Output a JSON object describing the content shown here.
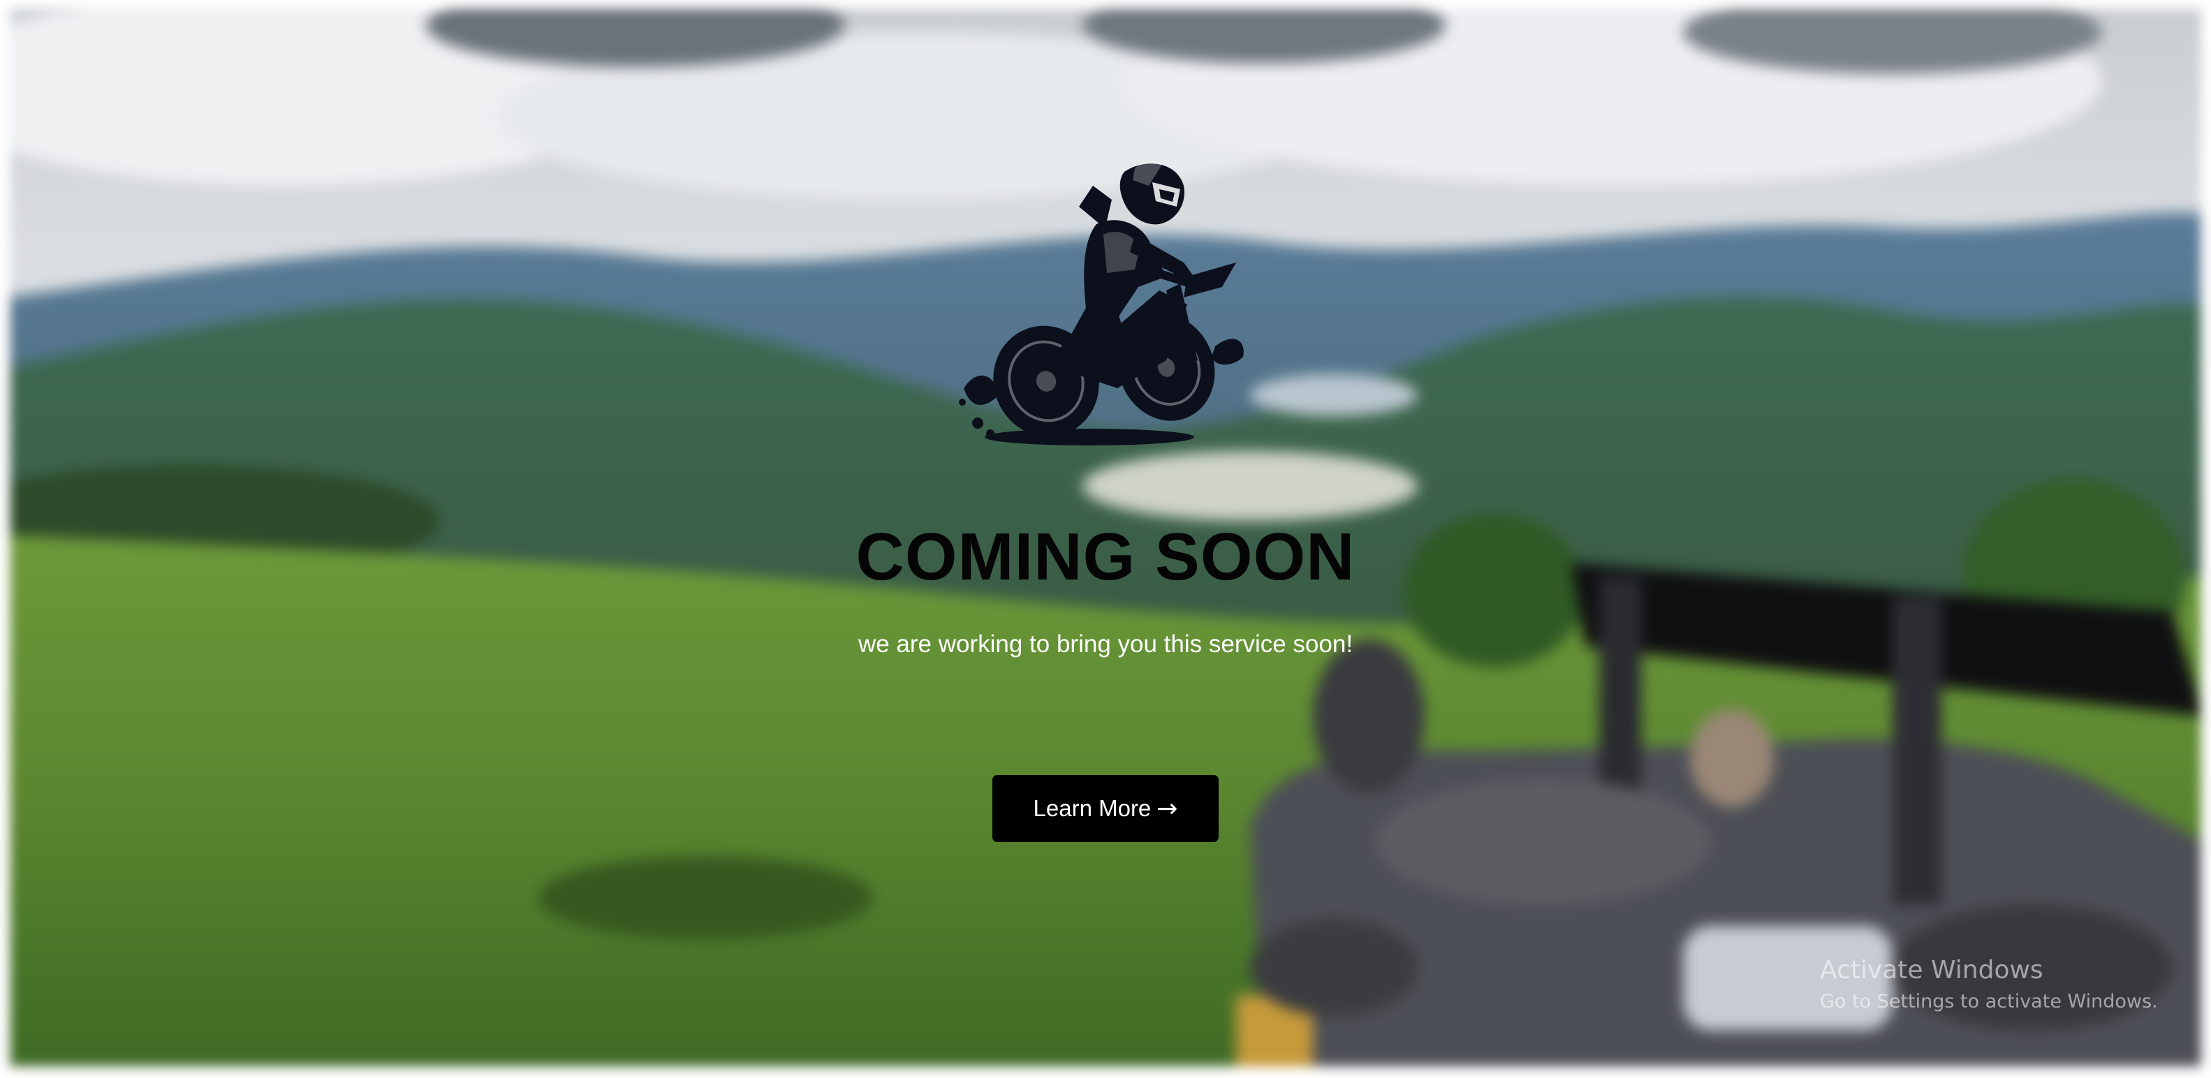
{
  "hero": {
    "title": "COMING SOON",
    "subtitle": "we are working to bring you this service soon!",
    "button_label": "Learn More",
    "button_arrow": "→"
  },
  "background": {
    "description_icon": "mountain-landscape-background"
  },
  "logo": {
    "icon": "motocross-rider-icon"
  },
  "watermark": {
    "title": "Activate Windows",
    "subtitle": "Go to Settings to activate Windows."
  },
  "colors": {
    "title": "#050505",
    "subtitle": "#ffffff",
    "button_bg": "#000000",
    "button_text": "#ffffff"
  }
}
